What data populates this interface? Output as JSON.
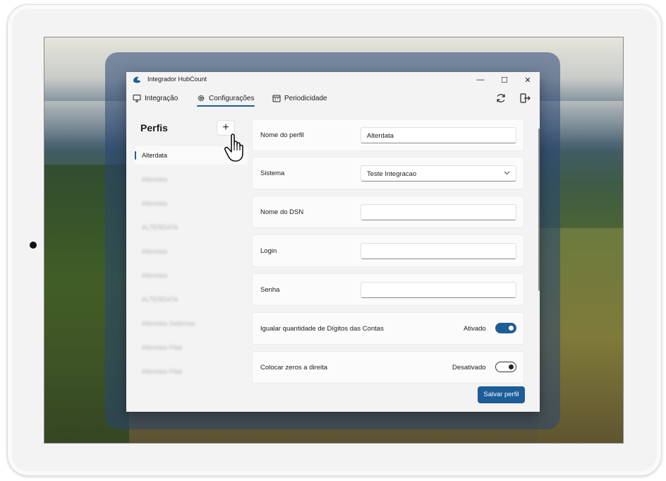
{
  "window": {
    "title": "Integrador HubCount",
    "minimize_glyph": "—",
    "maximize_glyph": "☐",
    "close_glyph": "✕"
  },
  "tabs": [
    {
      "label": "Integração",
      "icon": "monitor-icon"
    },
    {
      "label": "Configurações",
      "icon": "gear-icon",
      "active": true
    },
    {
      "label": "Periodicidade",
      "icon": "calendar-icon"
    }
  ],
  "header_actions": {
    "refresh_icon": "refresh-icon",
    "logout_icon": "logout-icon"
  },
  "sidebar": {
    "title": "Perfis",
    "add_label": "+",
    "items": [
      {
        "label": "Alterdata",
        "active": true
      },
      {
        "label": "Alterdata"
      },
      {
        "label": "Alterdata"
      },
      {
        "label": "ALTERDATA"
      },
      {
        "label": "Alterdata"
      },
      {
        "label": "Alterdata"
      },
      {
        "label": "ALTERDATA"
      },
      {
        "label": "Alterdata Sistemas"
      },
      {
        "label": "Alterdata Filial"
      },
      {
        "label": "Alterdata Filial"
      }
    ]
  },
  "form": {
    "profile_name": {
      "label": "Nome do perfil",
      "value": "Alterdata"
    },
    "system": {
      "label": "Sistema",
      "value": "Teste Integracao"
    },
    "dsn": {
      "label": "Nome do DSN",
      "value": ""
    },
    "login": {
      "label": "Login",
      "value": ""
    },
    "password": {
      "label": "Senha",
      "value": ""
    },
    "equal_digits": {
      "label": "Igualar quantidade de Dígitos das Contas",
      "state": "Ativado",
      "on": true
    },
    "zeros_right": {
      "label": "Colocar zeros a direita",
      "state": "Desativado",
      "on": false
    },
    "save_label": "Salvar perfil"
  },
  "colors": {
    "accent": "#1d5d98",
    "window_bg": "#f3f3f3"
  }
}
